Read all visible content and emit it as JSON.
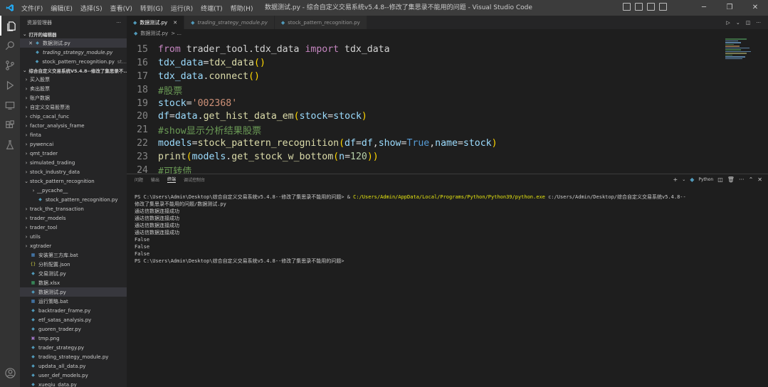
{
  "menubar": {
    "items": [
      "文件(F)",
      "编辑(E)",
      "选择(S)",
      "查看(V)",
      "转到(G)",
      "运行(R)",
      "终端(T)",
      "帮助(H)"
    ],
    "title": "数据测试.py - 综合自定义交易系统v5.4.8--修改了集思录不能用的问题 - Visual Studio Code"
  },
  "sidebar": {
    "header": "资源管理器",
    "open_editors_label": "打开的编辑器",
    "open_editors": [
      {
        "name": "数据测试.py",
        "active": true
      },
      {
        "name": "trading_strategy_module.py",
        "italic": true
      },
      {
        "name": "stock_pattern_recognition.py",
        "desc": "st..."
      }
    ],
    "project_label": "综合自定义交易系统V5.4.8--修改了集思录不...",
    "items": [
      {
        "label": "买入股票",
        "type": "folder"
      },
      {
        "label": "卖出股票",
        "type": "folder"
      },
      {
        "label": "账户数据",
        "type": "folder"
      },
      {
        "label": "自定义交易股票池",
        "type": "folder"
      },
      {
        "label": "chip_cacal_func",
        "type": "folder"
      },
      {
        "label": "factor_analysis_frame",
        "type": "folder"
      },
      {
        "label": "finta",
        "type": "folder"
      },
      {
        "label": "pywencai",
        "type": "folder"
      },
      {
        "label": "qmt_trader",
        "type": "folder"
      },
      {
        "label": "simulated_trading",
        "type": "folder"
      },
      {
        "label": "stock_industry_data",
        "type": "folder"
      },
      {
        "label": "stock_pattern_recognition",
        "type": "folder-open"
      },
      {
        "label": "__pycache__",
        "type": "subfolder"
      },
      {
        "label": "stock_pattern_recognition.py",
        "type": "subpy"
      },
      {
        "label": "track_the_transaction",
        "type": "folder"
      },
      {
        "label": "trader_models",
        "type": "folder"
      },
      {
        "label": "trader_tool",
        "type": "folder"
      },
      {
        "label": "utils",
        "type": "folder"
      },
      {
        "label": "xgtrader",
        "type": "folder"
      },
      {
        "label": "安装第三方库.bat",
        "type": "bat"
      },
      {
        "label": "分析配置.json",
        "type": "json"
      },
      {
        "label": "交易测试.py",
        "type": "py"
      },
      {
        "label": "数据.xlsx",
        "type": "xlsx"
      },
      {
        "label": "数据测试.py",
        "type": "py",
        "selected": true
      },
      {
        "label": "运行策略.bat",
        "type": "bat"
      },
      {
        "label": "backtrader_frame.py",
        "type": "py"
      },
      {
        "label": "etf_satas_analysis.py",
        "type": "py"
      },
      {
        "label": "guoren_trader.py",
        "type": "py"
      },
      {
        "label": "tmp.png",
        "type": "png"
      },
      {
        "label": "trader_strategy.py",
        "type": "py"
      },
      {
        "label": "trading_strategy_module.py",
        "type": "py"
      },
      {
        "label": "updata_all_data.py",
        "type": "py"
      },
      {
        "label": "user_def_models.py",
        "type": "py"
      },
      {
        "label": "xueqiu_data.py",
        "type": "py"
      }
    ]
  },
  "tabs": [
    {
      "label": "数据测试.py",
      "active": true
    },
    {
      "label": "trading_strategy_module.py",
      "italic": true
    },
    {
      "label": "stock_pattern_recognition.py"
    }
  ],
  "breadcrumb": {
    "file": "数据测试.py",
    "rest": "> ..."
  },
  "code_lines": [
    {
      "n": "15",
      "tokens": [
        [
          "kw",
          "from"
        ],
        [
          "pl",
          " trader_tool.tdx_data "
        ],
        [
          "kw",
          "import"
        ],
        [
          "pl",
          " tdx_data"
        ]
      ]
    },
    {
      "n": "16",
      "tokens": [
        [
          "va",
          "tdx_data"
        ],
        [
          "pl",
          "="
        ],
        [
          "fn",
          "tdx_data"
        ],
        [
          "py",
          "()"
        ]
      ]
    },
    {
      "n": "17",
      "tokens": [
        [
          "va",
          "tdx_data"
        ],
        [
          "pl",
          "."
        ],
        [
          "fn",
          "connect"
        ],
        [
          "py",
          "()"
        ]
      ]
    },
    {
      "n": "18",
      "tokens": [
        [
          "cm",
          "#股票"
        ]
      ]
    },
    {
      "n": "19",
      "tokens": [
        [
          "va",
          "stock"
        ],
        [
          "pl",
          "="
        ],
        [
          "st",
          "'002368'"
        ]
      ]
    },
    {
      "n": "20",
      "tokens": [
        [
          "va",
          "df"
        ],
        [
          "pl",
          "="
        ],
        [
          "va",
          "data"
        ],
        [
          "pl",
          "."
        ],
        [
          "fn",
          "get_hist_data_em"
        ],
        [
          "py",
          "("
        ],
        [
          "va",
          "stock"
        ],
        [
          "pl",
          "="
        ],
        [
          "va",
          "stock"
        ],
        [
          "py",
          ")"
        ]
      ]
    },
    {
      "n": "21",
      "tokens": [
        [
          "cm",
          "#show显示分析结果股票"
        ]
      ]
    },
    {
      "n": "22",
      "tokens": [
        [
          "va",
          "models"
        ],
        [
          "pl",
          "="
        ],
        [
          "fn",
          "stock_pattern_recognition"
        ],
        [
          "py",
          "("
        ],
        [
          "va",
          "df"
        ],
        [
          "pl",
          "="
        ],
        [
          "va",
          "df"
        ],
        [
          "pl",
          ","
        ],
        [
          "va",
          "show"
        ],
        [
          "pl",
          "="
        ],
        [
          "bl",
          "True"
        ],
        [
          "pl",
          ","
        ],
        [
          "va",
          "name"
        ],
        [
          "pl",
          "="
        ],
        [
          "va",
          "stock"
        ],
        [
          "py",
          ")"
        ]
      ]
    },
    {
      "n": "23",
      "tokens": [
        [
          "fn",
          "print"
        ],
        [
          "py",
          "("
        ],
        [
          "va",
          "models"
        ],
        [
          "pl",
          "."
        ],
        [
          "fn",
          "get_stock_w_bottom"
        ],
        [
          "py",
          "("
        ],
        [
          "va",
          "n"
        ],
        [
          "pl",
          "="
        ],
        [
          "nu",
          "120"
        ],
        [
          "py",
          "))"
        ]
      ]
    },
    {
      "n": "24",
      "tokens": [
        [
          "cm",
          "#可转债"
        ]
      ]
    }
  ],
  "panel": {
    "tabs": [
      "问题",
      "输出",
      "终端",
      "调试控制台"
    ],
    "active_tab": "终端",
    "shell": "Python",
    "terminal": {
      "cmd_prefix": "PS C:\\Users\\Admin\\Desktop\\综合自定义交易系统v5.4.8--修改了集思录不能用的问题> & ",
      "cmd_exe": "C:/Users/Admin/AppData/Local/Programs/Python/Python39/python.exe",
      "cmd_arg": " c:/Users/Admin/Desktop/综合自定义交易系统v5.4.8--",
      "cmd_cont": "修改了集思录不能用的问题/数据测试.py",
      "output": [
        "通达信数据连接成功",
        "通达信数据连接成功",
        "通达信数据连接成功",
        "通达信数据连接成功",
        "False",
        "False",
        "False"
      ],
      "prompt": "PS C:\\Users\\Admin\\Desktop\\综合自定义交易系统v5.4.8--修改了集思录不能用的问题>"
    }
  }
}
